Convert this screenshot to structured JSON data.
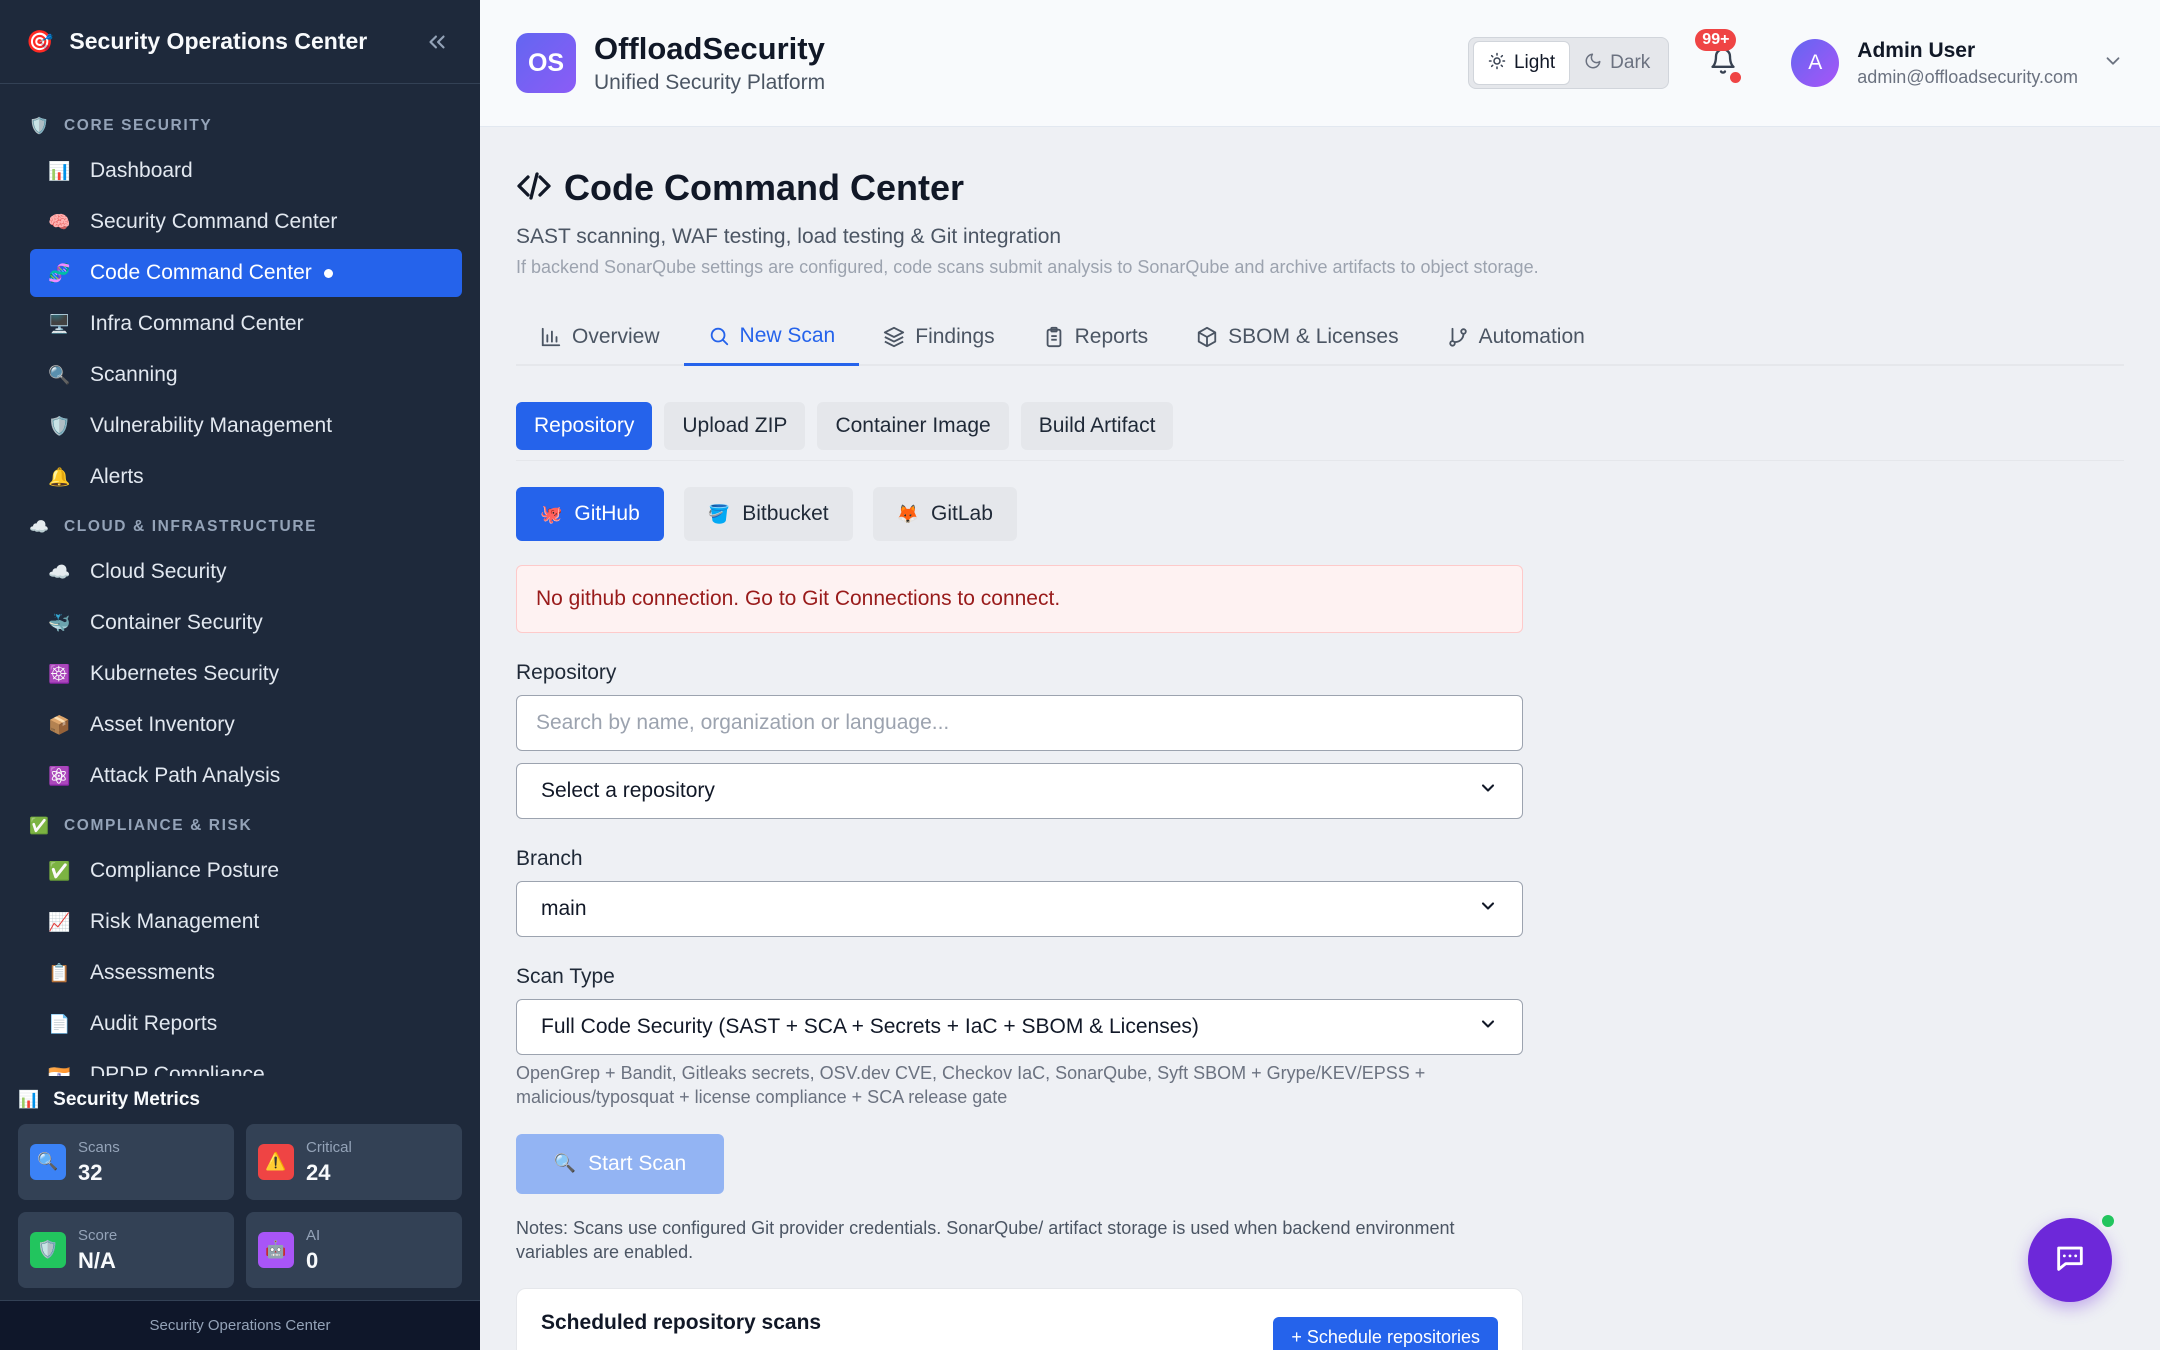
{
  "sidebar": {
    "title": "Security Operations Center",
    "sections": [
      {
        "label": "CORE SECURITY",
        "icon": "🛡️",
        "items": [
          {
            "label": "Dashboard",
            "icon": "📊"
          },
          {
            "label": "Security Command Center",
            "icon": "🧠"
          },
          {
            "label": "Code Command Center",
            "icon": "🧬",
            "active": true
          },
          {
            "label": "Infra Command Center",
            "icon": "🖥️"
          },
          {
            "label": "Scanning",
            "icon": "🔍"
          },
          {
            "label": "Vulnerability Management",
            "icon": "🛡️"
          },
          {
            "label": "Alerts",
            "icon": "🔔"
          }
        ]
      },
      {
        "label": "CLOUD & INFRASTRUCTURE",
        "icon": "☁️",
        "items": [
          {
            "label": "Cloud Security",
            "icon": "☁️"
          },
          {
            "label": "Container Security",
            "icon": "🐳"
          },
          {
            "label": "Kubernetes Security",
            "icon": "☸️"
          },
          {
            "label": "Asset Inventory",
            "icon": "📦"
          },
          {
            "label": "Attack Path Analysis",
            "icon": "⚛️"
          }
        ]
      },
      {
        "label": "COMPLIANCE & RISK",
        "icon": "✅",
        "items": [
          {
            "label": "Compliance Posture",
            "icon": "✅"
          },
          {
            "label": "Risk Management",
            "icon": "📈"
          },
          {
            "label": "Assessments",
            "icon": "📋"
          },
          {
            "label": "Audit Reports",
            "icon": "📄"
          },
          {
            "label": "DPDP Compliance",
            "icon": "🇮🇳"
          }
        ]
      }
    ],
    "metrics_title": "Security Metrics",
    "metrics": [
      {
        "label": "Scans",
        "value": "32",
        "icon": "🔍",
        "color": "#3b82f6"
      },
      {
        "label": "Critical",
        "value": "24",
        "icon": "⚠️",
        "color": "#ef4444"
      },
      {
        "label": "Score",
        "value": "N/A",
        "icon": "🛡️",
        "color": "#22c55e"
      },
      {
        "label": "AI",
        "value": "0",
        "icon": "🤖",
        "color": "#a855f7"
      }
    ],
    "footer": "Security Operations Center"
  },
  "topbar": {
    "logo_text": "OS",
    "brand": "OffloadSecurity",
    "tagline": "Unified Security Platform",
    "theme_light": "Light",
    "theme_dark": "Dark",
    "notifications": "99+",
    "user_initial": "A",
    "user_name": "Admin User",
    "user_email": "admin@offloadsecurity.com"
  },
  "page": {
    "title": "Code Command Center",
    "subtitle": "SAST scanning, WAF testing, load testing & Git integration",
    "note": "If backend SonarQube settings are configured, code scans submit analysis to SonarQube and archive artifacts to object storage.",
    "tabs": [
      {
        "label": "Overview",
        "icon": "chart-icon"
      },
      {
        "label": "New Scan",
        "icon": "search-icon",
        "active": true
      },
      {
        "label": "Findings",
        "icon": "layers-icon"
      },
      {
        "label": "Reports",
        "icon": "clipboard-icon"
      },
      {
        "label": "SBOM & Licenses",
        "icon": "package-icon"
      },
      {
        "label": "Automation",
        "icon": "git-branch-icon"
      }
    ],
    "sources": [
      {
        "label": "Repository",
        "active": true
      },
      {
        "label": "Upload ZIP"
      },
      {
        "label": "Container Image"
      },
      {
        "label": "Build Artifact"
      }
    ],
    "providers": [
      {
        "label": "GitHub",
        "icon": "🐙",
        "active": true
      },
      {
        "label": "Bitbucket",
        "icon": "🪣"
      },
      {
        "label": "GitLab",
        "icon": "🦊"
      }
    ]
  },
  "form": {
    "alert": "No github connection. Go to Git Connections to connect.",
    "repository_label": "Repository",
    "search_placeholder": "Search by name, organization or language...",
    "repo_select": "Select a repository",
    "branch_label": "Branch",
    "branch_value": "main",
    "scan_type_label": "Scan Type",
    "scan_type_value": "Full Code Security (SAST + SCA + Secrets + IaC + SBOM & Licenses)",
    "scan_type_help": "OpenGrep + Bandit, Gitleaks secrets, OSV.dev CVE, Checkov IaC, SonarQube, Syft SBOM + Grype/KEV/EPSS + malicious/typosquat + license compliance + SCA release gate",
    "start_button": "Start Scan",
    "notes": "Notes: Scans use configured Git provider credentials. SonarQube/ artifact storage is used when backend environment variables are enabled."
  },
  "scheduled": {
    "title": "Scheduled repository scans",
    "button": "+ Schedule repositories"
  }
}
